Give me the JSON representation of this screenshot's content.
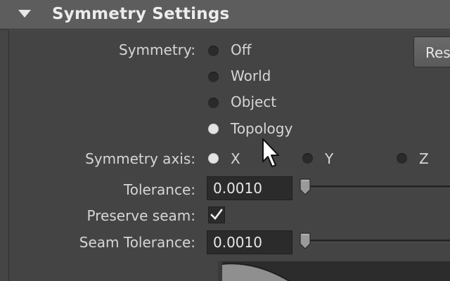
{
  "section": {
    "title": "Symmetry Settings",
    "collapse_icon": "triangle-down-icon"
  },
  "reset_button": {
    "label": "Reset"
  },
  "symmetry": {
    "label": "Symmetry:",
    "options": [
      "Off",
      "World",
      "Object",
      "Topology"
    ],
    "selected": "Topology"
  },
  "symmetry_axis": {
    "label": "Symmetry axis:",
    "options": [
      "X",
      "Y",
      "Z"
    ],
    "selected": "X"
  },
  "tolerance": {
    "label": "Tolerance:",
    "value": "0.0010",
    "slider_level": 0
  },
  "preserve_seam": {
    "label": "Preserve seam:",
    "checked": true
  },
  "seam_tolerance": {
    "label": "Seam Tolerance:",
    "value": "0.0010",
    "slider_level": 0
  },
  "colors": {
    "header_bg": "#5d5d5d",
    "panel_bg": "#444444",
    "field_bg": "#2b2b2b",
    "text": "#d6d6d6"
  }
}
